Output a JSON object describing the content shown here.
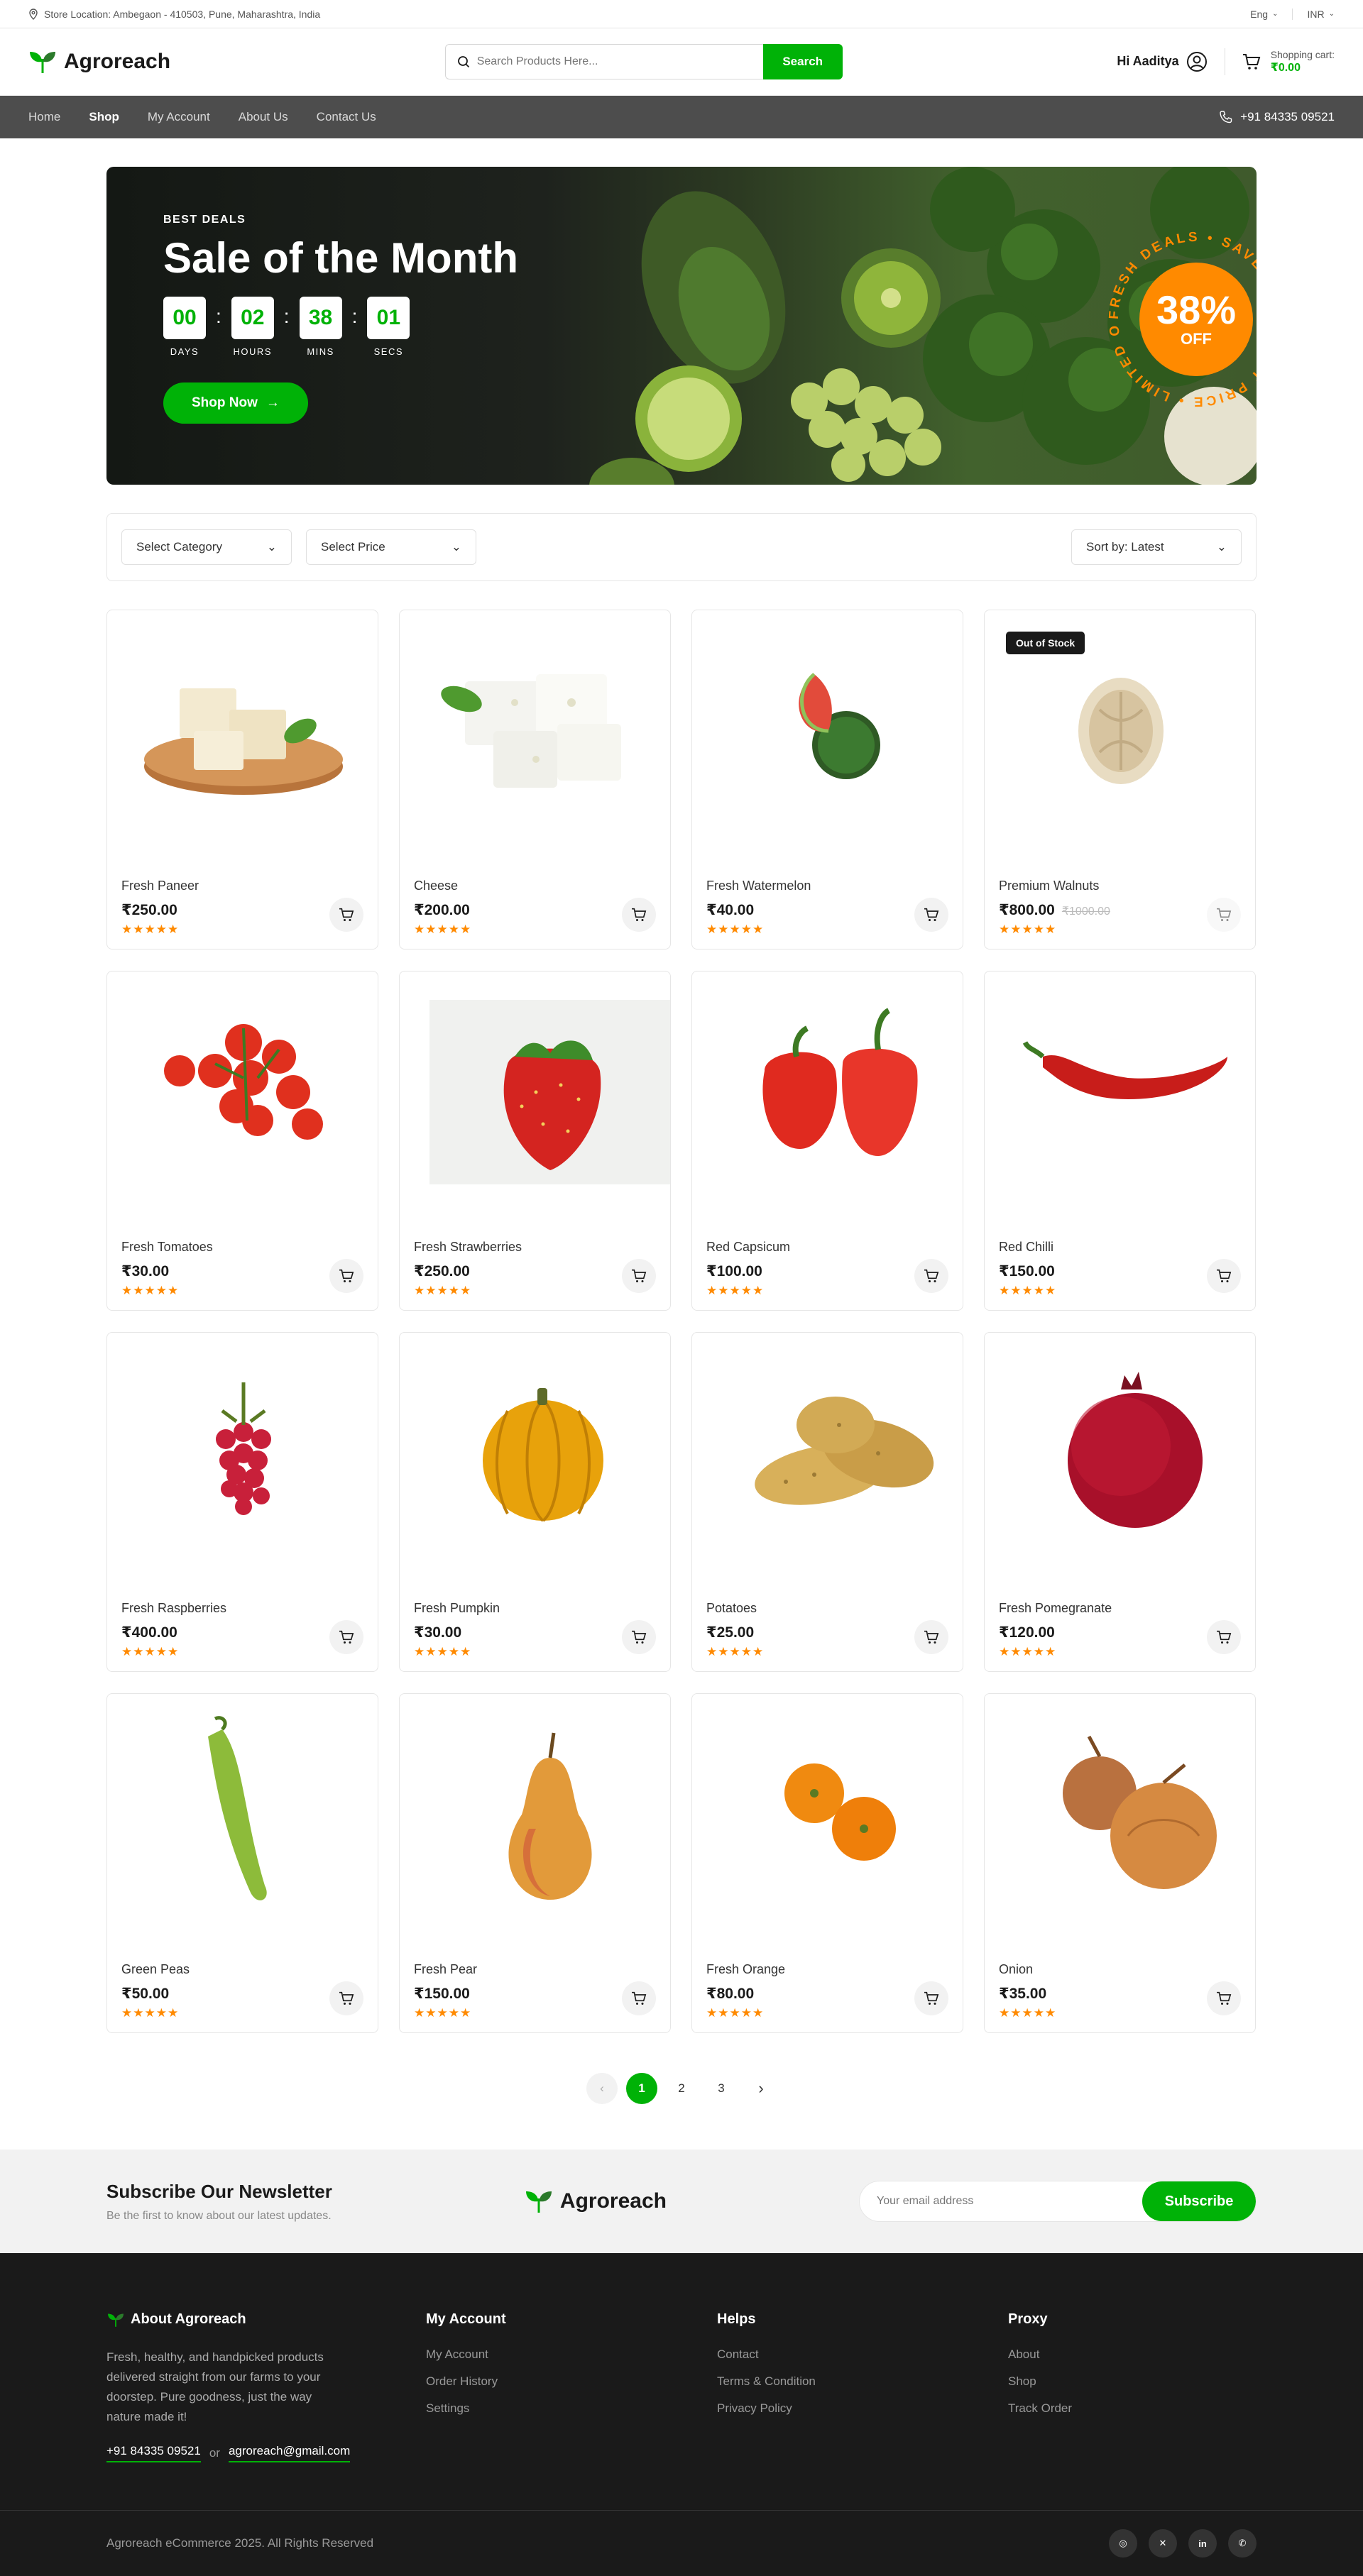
{
  "topbar": {
    "location": "Store Location: Ambegaon - 410503, Pune, Maharashtra, India",
    "language": "Eng",
    "currency": "INR"
  },
  "header": {
    "brand": "Agroreach",
    "search_placeholder": "Search Products Here...",
    "search_button": "Search",
    "greeting": "Hi Aaditya",
    "cart_label": "Shopping cart:",
    "cart_amount": "₹0.00"
  },
  "nav": {
    "links": [
      "Home",
      "Shop",
      "My Account",
      "About Us",
      "Contact Us"
    ],
    "active": "Shop",
    "phone": "+91 84335 09521"
  },
  "banner": {
    "eyebrow": "BEST DEALS",
    "title": "Sale of the Month",
    "countdown": [
      {
        "value": "00",
        "label": "DAYS"
      },
      {
        "value": "02",
        "label": "HOURS"
      },
      {
        "value": "38",
        "label": "MINS"
      },
      {
        "value": "01",
        "label": "SECS"
      }
    ],
    "cta": "Shop Now",
    "badge_percent": "38%",
    "badge_off": "OFF",
    "badge_ring_text": "FRESH DEALS • SAVE NOW • BEST PRICE • LIMITED OFFER •"
  },
  "filters": {
    "category": "Select Category",
    "price": "Select Price",
    "sort": "Sort by: Latest"
  },
  "products": [
    {
      "name": "Fresh Paneer",
      "price": "₹250.00",
      "old_price": "",
      "rating": 5,
      "badge": "",
      "icon": "paneer"
    },
    {
      "name": "Cheese",
      "price": "₹200.00",
      "old_price": "",
      "rating": 5,
      "badge": "",
      "icon": "cheese"
    },
    {
      "name": "Fresh Watermelon",
      "price": "₹40.00",
      "old_price": "",
      "rating": 5,
      "badge": "",
      "icon": "watermelon"
    },
    {
      "name": "Premium Walnuts",
      "price": "₹800.00",
      "old_price": "₹1000.00",
      "rating": 5,
      "badge": "Out of Stock",
      "icon": "walnut"
    },
    {
      "name": "Fresh Tomatoes",
      "price": "₹30.00",
      "old_price": "",
      "rating": 5,
      "badge": "",
      "icon": "tomatoes"
    },
    {
      "name": "Fresh Strawberries",
      "price": "₹250.00",
      "old_price": "",
      "rating": 5,
      "badge": "",
      "icon": "strawberry"
    },
    {
      "name": "Red Capsicum",
      "price": "₹100.00",
      "old_price": "",
      "rating": 5,
      "badge": "",
      "icon": "capsicum"
    },
    {
      "name": "Red Chilli",
      "price": "₹150.00",
      "old_price": "",
      "rating": 5,
      "badge": "",
      "icon": "chilli"
    },
    {
      "name": "Fresh Raspberries",
      "price": "₹400.00",
      "old_price": "",
      "rating": 5,
      "badge": "",
      "icon": "raspberry"
    },
    {
      "name": "Fresh Pumpkin",
      "price": "₹30.00",
      "old_price": "",
      "rating": 5,
      "badge": "",
      "icon": "pumpkin"
    },
    {
      "name": "Potatoes",
      "price": "₹25.00",
      "old_price": "",
      "rating": 5,
      "badge": "",
      "icon": "potatoes"
    },
    {
      "name": "Fresh Pomegranate",
      "price": "₹120.00",
      "old_price": "",
      "rating": 5,
      "badge": "",
      "icon": "pomegranate"
    },
    {
      "name": "Green Peas",
      "price": "₹50.00",
      "old_price": "",
      "rating": 5,
      "badge": "",
      "icon": "peas"
    },
    {
      "name": "Fresh Pear",
      "price": "₹150.00",
      "old_price": "",
      "rating": 5,
      "badge": "",
      "icon": "pear"
    },
    {
      "name": "Fresh Orange",
      "price": "₹80.00",
      "old_price": "",
      "rating": 5,
      "badge": "",
      "icon": "orange"
    },
    {
      "name": "Onion",
      "price": "₹35.00",
      "old_price": "",
      "rating": 5,
      "badge": "",
      "icon": "onion"
    }
  ],
  "pagination": {
    "pages": [
      "1",
      "2",
      "3"
    ],
    "current": "1"
  },
  "newsletter": {
    "title": "Subscribe Our Newsletter",
    "subtitle": "Be the first to know about our latest updates.",
    "brand": "Agroreach",
    "placeholder": "Your email address",
    "button": "Subscribe"
  },
  "footer": {
    "about_title": "About Agroreach",
    "about_text": "Fresh, healthy, and handpicked products delivered straight from our farms to your doorstep. Pure goodness, just the way nature made it!",
    "phone": "+91 84335 09521",
    "or": "or",
    "email": "agroreach@gmail.com",
    "columns": [
      {
        "title": "My Account",
        "links": [
          "My Account",
          "Order History",
          "Settings"
        ]
      },
      {
        "title": "Helps",
        "links": [
          "Contact",
          "Terms & Condition",
          "Privacy Policy"
        ]
      },
      {
        "title": "Proxy",
        "links": [
          "About",
          "Shop",
          "Track Order"
        ]
      }
    ],
    "copyright": "Agroreach eCommerce 2025. All Rights Reserved",
    "socials": [
      "instagram-icon",
      "twitter-icon",
      "linkedin-icon",
      "whatsapp-icon"
    ]
  },
  "colors": {
    "accent": "#00b207",
    "nav_bg": "#4d4d4d",
    "footer_bg": "#1a1a1a",
    "star": "#ff8a00"
  }
}
